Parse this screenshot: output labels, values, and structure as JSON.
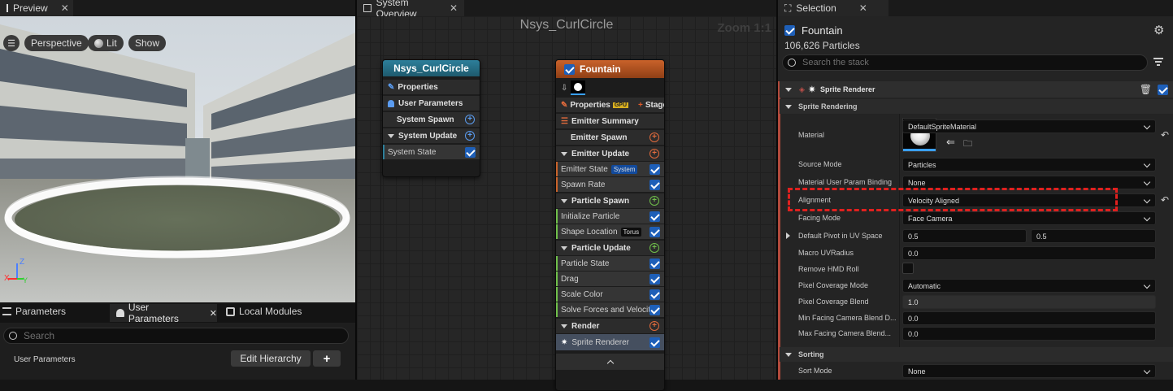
{
  "preview": {
    "tab_title": "Preview",
    "viewport_buttons": {
      "perspective": "Perspective",
      "lit": "Lit",
      "show": "Show"
    },
    "axes": {
      "z": "Z",
      "x": "X",
      "y": "Y"
    }
  },
  "bottom_panel": {
    "tabs": {
      "parameters": "Parameters",
      "user_parameters": "User Parameters",
      "local_modules": "Local Modules"
    },
    "search_placeholder": "Search",
    "section_label": "User Parameters",
    "edit_hierarchy": "Edit Hierarchy",
    "add": "+"
  },
  "system_overview": {
    "tab_title": "System Overview",
    "graph_title": "Nsys_CurlCircle",
    "zoom": "Zoom 1:1",
    "system_node": {
      "title": "Nsys_CurlCircle",
      "properties": "Properties",
      "user_parameters": "User Parameters",
      "system_spawn": "System Spawn",
      "system_update": "System Update",
      "system_state": "System State"
    },
    "emitter_node": {
      "title": "Fountain",
      "properties": "Properties",
      "gpu": "GPU",
      "stage": "Stage",
      "emitter_summary": "Emitter Summary",
      "emitter_spawn": "Emitter Spawn",
      "emitter_update": "Emitter Update",
      "emitter_state": "Emitter State",
      "emitter_state_tag": "System",
      "spawn_rate": "Spawn Rate",
      "particle_spawn": "Particle Spawn",
      "initialize_particle": "Initialize Particle",
      "shape_location": "Shape Location",
      "shape_location_tag": "Torus",
      "particle_update": "Particle Update",
      "particle_state": "Particle State",
      "drag": "Drag",
      "scale_color": "Scale Color",
      "solve_forces": "Solve Forces and Velocity",
      "render": "Render",
      "sprite_renderer": "Sprite Renderer"
    }
  },
  "selection": {
    "tab_title": "Selection",
    "emitter_name": "Fountain",
    "particle_count": "106,626 Particles",
    "search_placeholder": "Search the stack",
    "renderer_header": "Sprite Renderer",
    "sprite_rendering_section": "Sprite Rendering",
    "material_label": "Material",
    "material_value": "DefaultSpriteMaterial",
    "source_mode_label": "Source Mode",
    "source_mode_value": "Particles",
    "mat_param_binding_label": "Material User Param Binding",
    "mat_param_binding_value": "None",
    "alignment_label": "Alignment",
    "alignment_value": "Velocity Aligned",
    "facing_mode_label": "Facing Mode",
    "facing_mode_value": "Face Camera",
    "pivot_label": "Default Pivot in UV Space",
    "pivot_x": "0.5",
    "pivot_y": "0.5",
    "macro_uv_label": "Macro UVRadius",
    "macro_uv_value": "0.0",
    "remove_hmd_label": "Remove HMD Roll",
    "pixel_cov_mode_label": "Pixel Coverage Mode",
    "pixel_cov_mode_value": "Automatic",
    "pixel_cov_blend_label": "Pixel Coverage Blend",
    "pixel_cov_blend_value": "1.0",
    "min_facing_label": "Min Facing Camera Blend D...",
    "min_facing_value": "0.0",
    "max_facing_label": "Max Facing Camera Blend...",
    "max_facing_value": "0.0",
    "sorting_section": "Sorting",
    "sort_mode_label": "Sort Mode",
    "sort_mode_value": "None"
  },
  "colors": {
    "emitter_accent": "#c9622a",
    "system_accent": "#2d7f9a",
    "highlight_dash": "#e0201e",
    "checkbox": "#1e5fb8"
  }
}
